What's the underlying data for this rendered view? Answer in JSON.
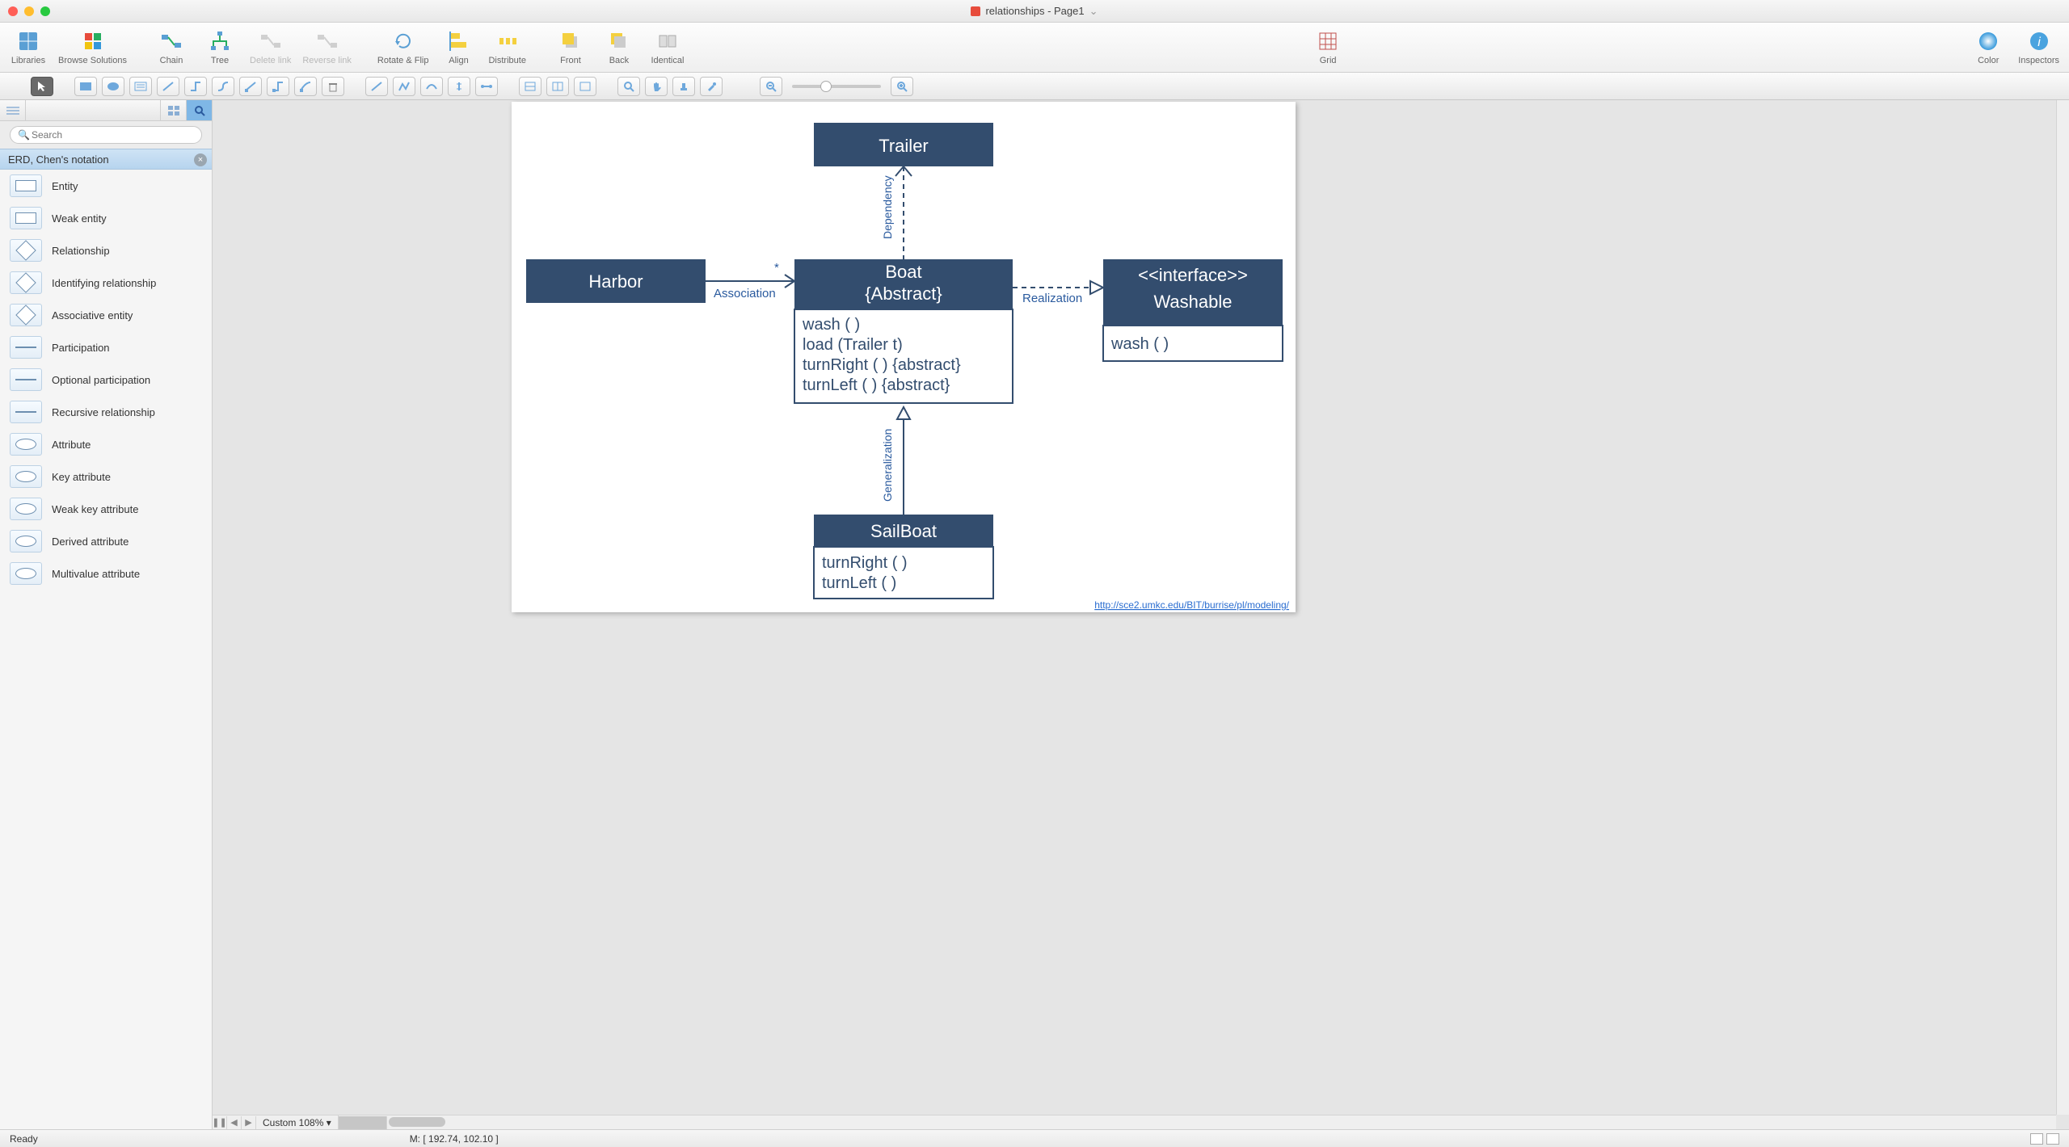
{
  "window": {
    "title": "relationships - Page1"
  },
  "toolbar": {
    "libraries": "Libraries",
    "browse": "Browse Solutions",
    "chain": "Chain",
    "tree": "Tree",
    "delete_link": "Delete link",
    "reverse_link": "Reverse link",
    "rotate_flip": "Rotate & Flip",
    "align": "Align",
    "distribute": "Distribute",
    "front": "Front",
    "back": "Back",
    "identical": "Identical",
    "grid": "Grid",
    "color": "Color",
    "inspectors": "Inspectors"
  },
  "sidebar": {
    "search_placeholder": "Search",
    "library_title": "ERD, Chen's notation",
    "items": [
      {
        "label": "Entity",
        "kind": "rect"
      },
      {
        "label": "Weak entity",
        "kind": "rect"
      },
      {
        "label": "Relationship",
        "kind": "diamond"
      },
      {
        "label": "Identifying relationship",
        "kind": "diamond"
      },
      {
        "label": "Associative entity",
        "kind": "diamond"
      },
      {
        "label": "Participation",
        "kind": "line"
      },
      {
        "label": "Optional participation",
        "kind": "line"
      },
      {
        "label": "Recursive relationship",
        "kind": "line"
      },
      {
        "label": "Attribute",
        "kind": "oval"
      },
      {
        "label": "Key attribute",
        "kind": "oval"
      },
      {
        "label": "Weak key attribute",
        "kind": "oval"
      },
      {
        "label": "Derived attribute",
        "kind": "oval"
      },
      {
        "label": "Multivalue attribute",
        "kind": "oval"
      }
    ]
  },
  "diagram": {
    "trailer": "Trailer",
    "harbor": "Harbor",
    "boat_name": "Boat",
    "boat_stereotype": "{Abstract}",
    "boat_ops": [
      "wash ( )",
      "load (Trailer t)",
      "turnRight ( ) {abstract}",
      "turnLeft ( ) {abstract}"
    ],
    "washable_stereotype": "<<interface>>",
    "washable_name": "Washable",
    "washable_ops": [
      "wash ( )"
    ],
    "sailboat_name": "SailBoat",
    "sailboat_ops": [
      "turnRight ( )",
      "turnLeft ( )"
    ],
    "rel_dependency": "Dependency",
    "rel_association": "Association",
    "rel_realization": "Realization",
    "rel_generalization": "Generalization",
    "assoc_mult": "*",
    "link": "http://sce2.umkc.edu/BIT/burrise/pl/modeling/"
  },
  "pagebar": {
    "zoom_label": "Custom 108%"
  },
  "status": {
    "ready": "Ready",
    "mouse": "M: [ 192.74, 102.10 ]"
  }
}
